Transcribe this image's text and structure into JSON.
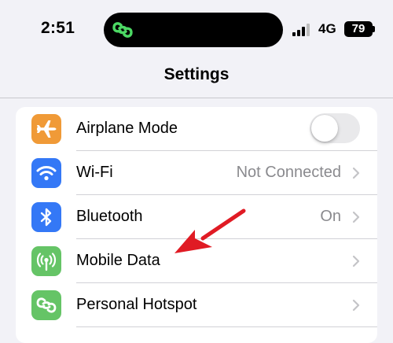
{
  "status_bar": {
    "time": "2:51",
    "network": "4G",
    "battery": "79",
    "island_icon": "hotspot-link-icon"
  },
  "nav": {
    "title": "Settings"
  },
  "settings": {
    "items": [
      {
        "label": "Airplane Mode",
        "value": "",
        "icon": "airplane-icon",
        "icon_color": "#f09a37",
        "control": "toggle",
        "toggle_on": false
      },
      {
        "label": "Wi-Fi",
        "value": "Not Connected",
        "icon": "wifi-icon",
        "icon_color": "#3478f6",
        "control": "chevron"
      },
      {
        "label": "Bluetooth",
        "value": "On",
        "icon": "bluetooth-icon",
        "icon_color": "#3478f6",
        "control": "chevron"
      },
      {
        "label": "Mobile Data",
        "value": "",
        "icon": "antenna-icon",
        "icon_color": "#65c466",
        "control": "chevron"
      },
      {
        "label": "Personal Hotspot",
        "value": "",
        "icon": "hotspot-link-icon",
        "icon_color": "#65c466",
        "control": "chevron"
      }
    ]
  },
  "annotation": {
    "arrow_color": "#e01b24",
    "arrow_target": "Mobile Data"
  },
  "colors": {
    "background": "#f2f2f7",
    "card": "#ffffff",
    "secondary_text": "#8a8a8e",
    "island_icon": "#4cd964"
  }
}
